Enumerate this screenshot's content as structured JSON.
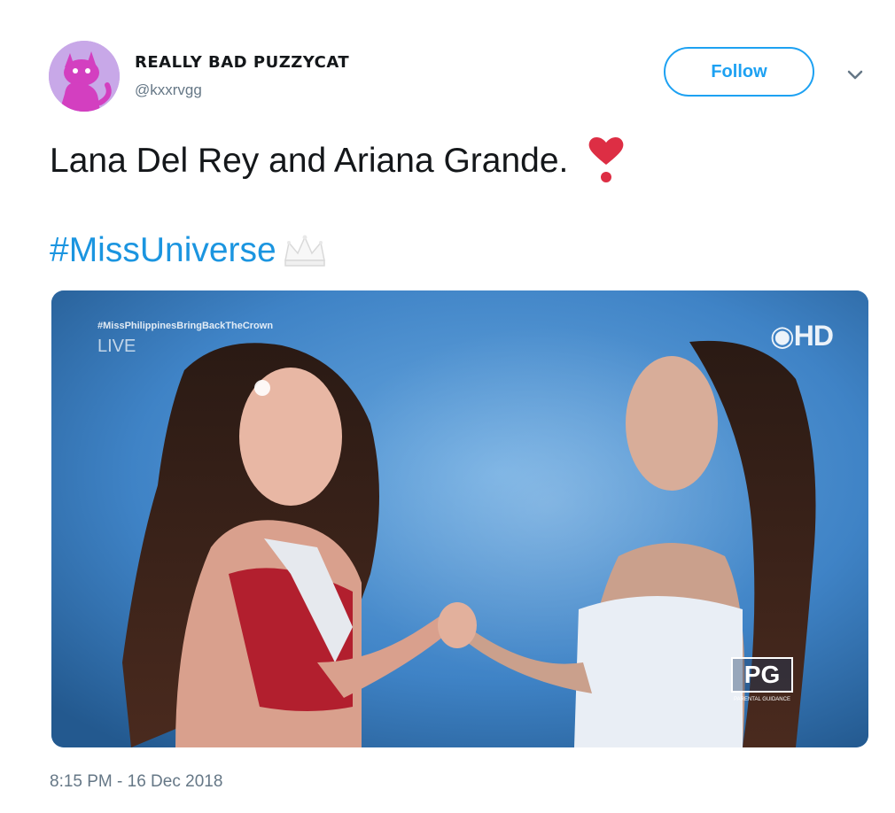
{
  "user": {
    "display_name": "REALLY BAD PUZZYCAT",
    "handle": "@kxxrvgg",
    "avatar_icon": "purple-cat-avatar"
  },
  "follow_button": {
    "label": "Follow"
  },
  "tweet": {
    "text": "Lana Del Rey and Ariana Grande.",
    "emoji": "heavy-heart-exclamation-icon",
    "hashtag": "#MissUniverse",
    "hashtag_emoji": "crown-icon",
    "timestamp": "8:15 PM - 16 Dec 2018"
  },
  "media": {
    "overlay_hashtag": "#MissPhilippinesBringBackTheCrown",
    "overlay_live": "LIVE",
    "channel_badge": "HD",
    "rating_badge": "PG",
    "rating_sub": "PARENTAL GUIDANCE"
  },
  "colors": {
    "accent": "#1da1f2",
    "hashtag": "#1b95e0",
    "heart": "#dd2e44",
    "media_bg": "#4a8fd0"
  }
}
